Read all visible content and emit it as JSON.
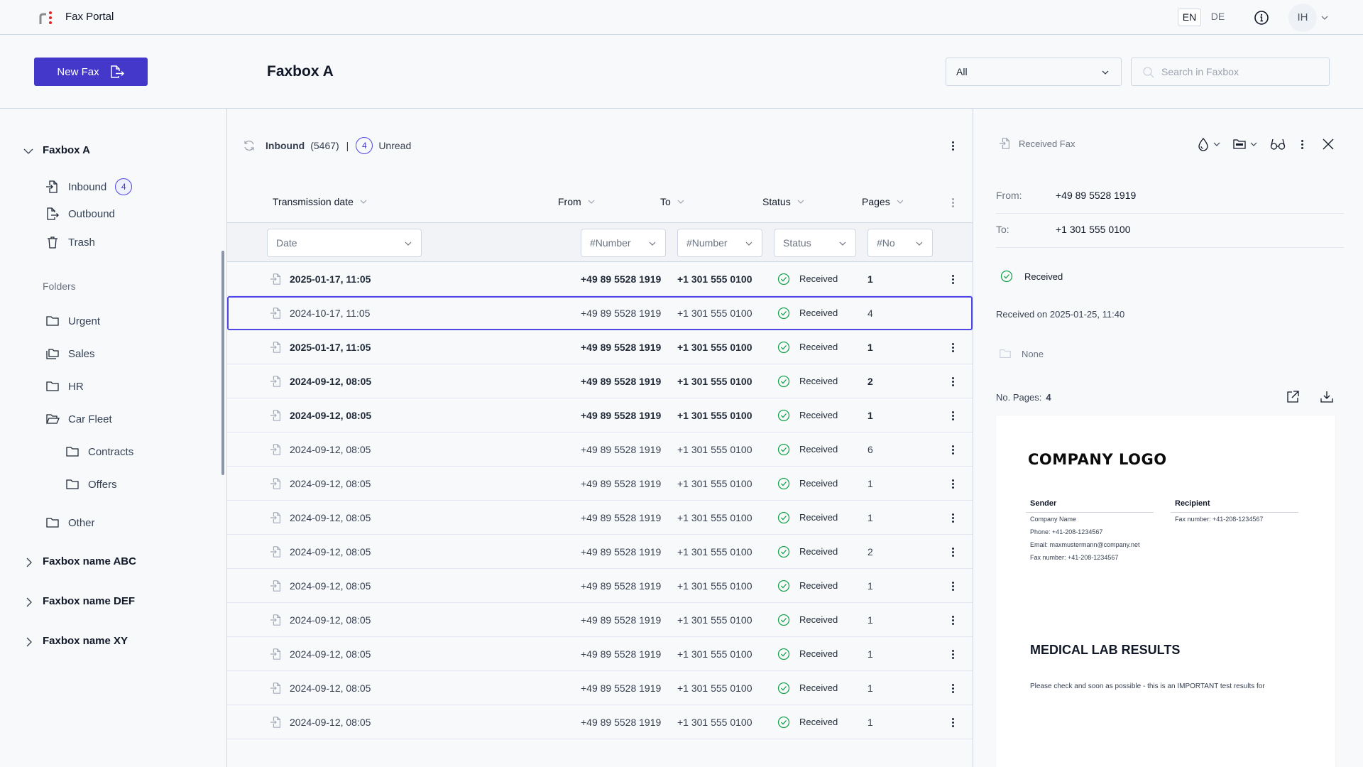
{
  "app": {
    "title": "Fax Portal",
    "languages": [
      {
        "code": "EN",
        "active": true
      },
      {
        "code": "DE",
        "active": false
      }
    ],
    "user_initials": "IH"
  },
  "toolbar": {
    "new_fax_label": "New Fax",
    "page_title": "Faxbox A",
    "filter_value": "All",
    "search_placeholder": "Search in Faxbox"
  },
  "sidebar": {
    "faxbox": "Faxbox A",
    "items": [
      {
        "label": "Inbound",
        "icon": "inbound-icon",
        "badge": "4"
      },
      {
        "label": "Outbound",
        "icon": "outbound-icon"
      },
      {
        "label": "Trash",
        "icon": "trash-icon"
      }
    ],
    "folders_title": "Folders",
    "folders": [
      {
        "label": "Urgent",
        "icon": "folder-icon"
      },
      {
        "label": "Sales",
        "icon": "folders-stack-icon"
      },
      {
        "label": "HR",
        "icon": "folder-icon"
      },
      {
        "label": "Car Fleet",
        "icon": "folder-open-icon"
      },
      {
        "label": "Contracts",
        "icon": "folder-icon",
        "child": true
      },
      {
        "label": "Offers",
        "icon": "folder-icon",
        "child": true
      },
      {
        "label": "Other",
        "icon": "folder-icon"
      }
    ],
    "other_faxboxes": [
      "Faxbox name ABC",
      "Faxbox name DEF",
      "Faxbox name XY"
    ]
  },
  "list": {
    "title": "Inbound",
    "count": "(5467)",
    "separator": "|",
    "unread_count": "4",
    "unread_label": "Unread",
    "columns": [
      "Transmission date",
      "From",
      "To",
      "Status",
      "Pages"
    ],
    "filters": {
      "date": "Date",
      "from": "#Number",
      "to": "#Number",
      "status": "Status",
      "pages": "#No"
    },
    "rows": [
      {
        "date": "2025-01-17, 11:05",
        "from": "+49 89 5528 1919",
        "to": "+1 301 555 0100",
        "status": "Received",
        "pages": "1",
        "unread": true,
        "selected": false
      },
      {
        "date": "2024-10-17, 11:05",
        "from": "+49 89 5528 1919",
        "to": "+1 301 555 0100",
        "status": "Received",
        "pages": "4",
        "unread": false,
        "selected": true
      },
      {
        "date": "2025-01-17, 11:05",
        "from": "+49 89 5528 1919",
        "to": "+1 301 555 0100",
        "status": "Received",
        "pages": "1",
        "unread": true,
        "selected": false
      },
      {
        "date": "2024-09-12, 08:05",
        "from": "+49 89 5528 1919",
        "to": "+1 301 555 0100",
        "status": "Received",
        "pages": "2",
        "unread": true,
        "selected": false
      },
      {
        "date": "2024-09-12, 08:05",
        "from": "+49 89 5528 1919",
        "to": "+1 301 555 0100",
        "status": "Received",
        "pages": "1",
        "unread": true,
        "selected": false
      },
      {
        "date": "2024-09-12, 08:05",
        "from": "+49 89 5528 1919",
        "to": "+1 301 555 0100",
        "status": "Received",
        "pages": "6",
        "unread": false,
        "selected": false
      },
      {
        "date": "2024-09-12, 08:05",
        "from": "+49 89 5528 1919",
        "to": "+1 301 555 0100",
        "status": "Received",
        "pages": "1",
        "unread": false,
        "selected": false
      },
      {
        "date": "2024-09-12, 08:05",
        "from": "+49 89 5528 1919",
        "to": "+1 301 555 0100",
        "status": "Received",
        "pages": "1",
        "unread": false,
        "selected": false
      },
      {
        "date": "2024-09-12, 08:05",
        "from": "+49 89 5528 1919",
        "to": "+1 301 555 0100",
        "status": "Received",
        "pages": "2",
        "unread": false,
        "selected": false
      },
      {
        "date": "2024-09-12, 08:05",
        "from": "+49 89 5528 1919",
        "to": "+1 301 555 0100",
        "status": "Received",
        "pages": "1",
        "unread": false,
        "selected": false
      },
      {
        "date": "2024-09-12, 08:05",
        "from": "+49 89 5528 1919",
        "to": "+1 301 555 0100",
        "status": "Received",
        "pages": "1",
        "unread": false,
        "selected": false
      },
      {
        "date": "2024-09-12, 08:05",
        "from": "+49 89 5528 1919",
        "to": "+1 301 555 0100",
        "status": "Received",
        "pages": "1",
        "unread": false,
        "selected": false
      },
      {
        "date": "2024-09-12, 08:05",
        "from": "+49 89 5528 1919",
        "to": "+1 301 555 0100",
        "status": "Received",
        "pages": "1",
        "unread": false,
        "selected": false
      },
      {
        "date": "2024-09-12, 08:05",
        "from": "+49 89 5528 1919",
        "to": "+1 301 555 0100",
        "status": "Received",
        "pages": "1",
        "unread": false,
        "selected": false
      }
    ]
  },
  "detail": {
    "title": "Received Fax",
    "from_label": "From:",
    "from_value": "+49 89 5528 1919",
    "to_label": "To:",
    "to_value": "+1 301 555 0100",
    "status": "Received",
    "received_on": "Received on 2025-01-25, 11:40",
    "folder": "None",
    "pages_label": "No. Pages:",
    "pages_value": "4",
    "preview": {
      "logo": "COMPANY LOGO",
      "sender_heading": "Sender",
      "sender_lines": [
        "Company Name",
        "Phone: +41-208-1234567",
        "Email: maxmustermann@company.net",
        "Fax number: +41-208-1234567"
      ],
      "recipient_heading": "Recipient",
      "recipient_lines": [
        "Fax number: +41-208-1234567"
      ],
      "heading": "MEDICAL LAB RESULTS",
      "body": "Please check and  soon as possible - this is an IMPORTANT test results for"
    }
  },
  "colors": {
    "accent": "#4338ca",
    "selected_border": "#4f46e5",
    "success": "#16a34a",
    "border": "#cfd6e4",
    "logo_dots": "#dc2626"
  }
}
